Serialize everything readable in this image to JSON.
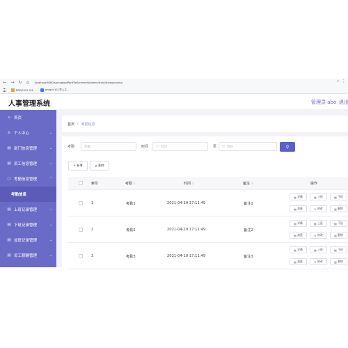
{
  "browser": {
    "url": "localhost:8080/springbootPartFileSchemeSt/admin/front/#/kaoqinxinxi",
    "right_icons": [
      "☆",
      "⋮"
    ],
    "bookmarks": [
      {
        "label": "ERP(2021 9/3...",
        "color": "#e5a33a"
      },
      {
        "label": "Insight 10 (导入工...",
        "color": "#3a7de5"
      }
    ]
  },
  "header": {
    "title": "人事管理系统",
    "user": "管理员 abo",
    "logout": "退出"
  },
  "sidebar": {
    "items": [
      {
        "label": "首页",
        "icon": "home-icon",
        "glyph": "⌂"
      },
      {
        "label": "个人中心",
        "icon": "user-icon",
        "glyph": "♙"
      },
      {
        "label": "部门信息管理",
        "icon": "menu-icon",
        "glyph": "▤"
      },
      {
        "label": "员工信息管理",
        "icon": "menu-icon",
        "glyph": "▤"
      },
      {
        "label": "考勤信息管理",
        "icon": "chat-icon",
        "glyph": "▢"
      },
      {
        "label": "考勤信息",
        "icon": "",
        "glyph": ""
      },
      {
        "label": "上班记录管理",
        "icon": "menu-icon",
        "glyph": "▤"
      },
      {
        "label": "下班记录管理",
        "icon": "menu-icon",
        "glyph": "▤"
      },
      {
        "label": "加班记录管理",
        "icon": "menu-icon",
        "glyph": "▤"
      },
      {
        "label": "员工薪酬管理",
        "icon": "menu-icon",
        "glyph": "▤"
      }
    ]
  },
  "breadcrumb": {
    "home": "首页",
    "sep": "/",
    "current": "考勤信息"
  },
  "search": {
    "kaoqin_label": "考勤",
    "kaoqin_placeholder": "考勤",
    "time_label": "时间",
    "time_placeholder": "时间",
    "to_label": "至",
    "to_placeholder": "时间"
  },
  "actions": {
    "add": "+ 新增",
    "delete": "删除"
  },
  "table": {
    "columns": [
      "索引",
      "考勤",
      "时间",
      "备注",
      "操作"
    ],
    "rows": [
      {
        "index": "1",
        "kaoqin": "考勤1",
        "time": "2021-04-19 17:11:49",
        "note": "备注1"
      },
      {
        "index": "2",
        "kaoqin": "考勤2",
        "time": "2021-04-19 17:11:49",
        "note": "备注2"
      },
      {
        "index": "3",
        "kaoqin": "考勤3",
        "time": "2021-04-19 17:11:49",
        "note": "备注3"
      }
    ],
    "row_buttons": [
      "详情",
      "上班",
      "下班",
      "加班",
      "修改",
      "删除"
    ]
  },
  "colors": {
    "accent": "#5b5fc7",
    "sidebar": "#6a6bc6"
  }
}
